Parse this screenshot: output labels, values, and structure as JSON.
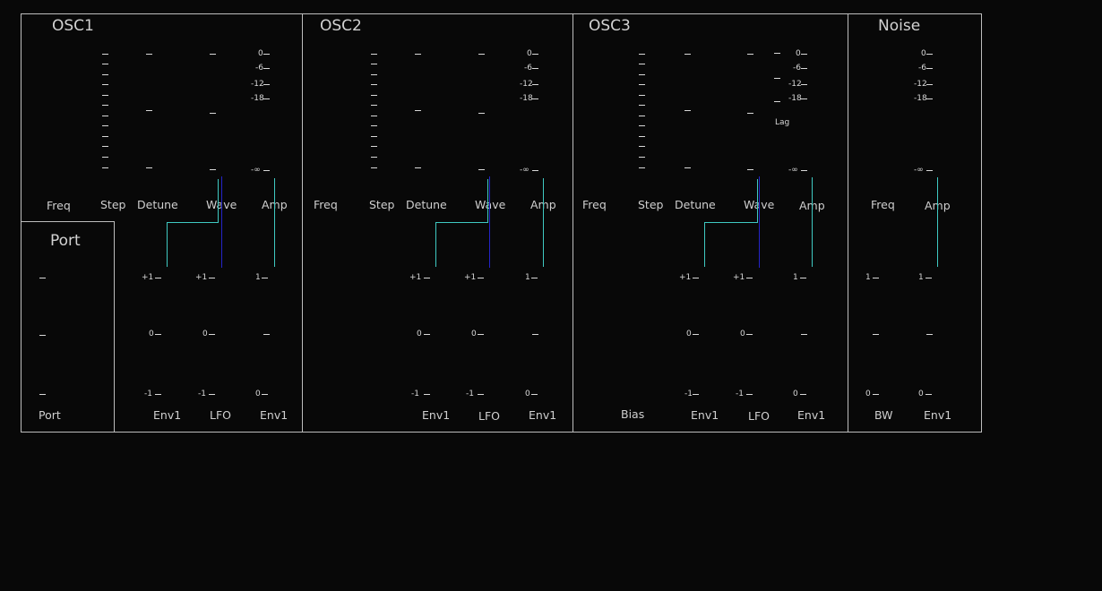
{
  "panels": {
    "osc1": {
      "title": "OSC1",
      "labels": {
        "freq": "Freq",
        "step": "Step",
        "detune": "Detune",
        "wave": "Wave",
        "amp": "Amp",
        "env1_a": "Env1",
        "lfo": "LFO",
        "env1_b": "Env1"
      }
    },
    "port": {
      "title": "Port",
      "labels": {
        "port": "Port"
      }
    },
    "osc2": {
      "title": "OSC2",
      "labels": {
        "freq": "Freq",
        "step": "Step",
        "detune": "Detune",
        "wave": "Wave",
        "amp": "Amp",
        "env1_a": "Env1",
        "lfo": "LFO",
        "env1_b": "Env1"
      }
    },
    "osc3": {
      "title": "OSC3",
      "labels": {
        "freq": "Freq",
        "step": "Step",
        "detune": "Detune",
        "wave": "Wave",
        "amp": "Amp",
        "bias": "Bias",
        "env1_a": "Env1",
        "lfo": "LFO",
        "env1_b": "Env1",
        "lag": "Lag"
      }
    },
    "noise": {
      "title": "Noise",
      "labels": {
        "freq": "Freq",
        "amp": "Amp",
        "bw": "BW",
        "env1": "Env1"
      }
    }
  },
  "scales": {
    "db": [
      "0",
      "-6",
      "-12",
      "-18",
      "-∞"
    ],
    "bipolar": [
      "+1",
      "0",
      "-1"
    ],
    "unipolar": [
      "1",
      "0"
    ]
  },
  "colors": {
    "background": "#080808",
    "border": "#bdbdbd",
    "cyan": "#3fc9c2",
    "blue": "#2424c8"
  }
}
